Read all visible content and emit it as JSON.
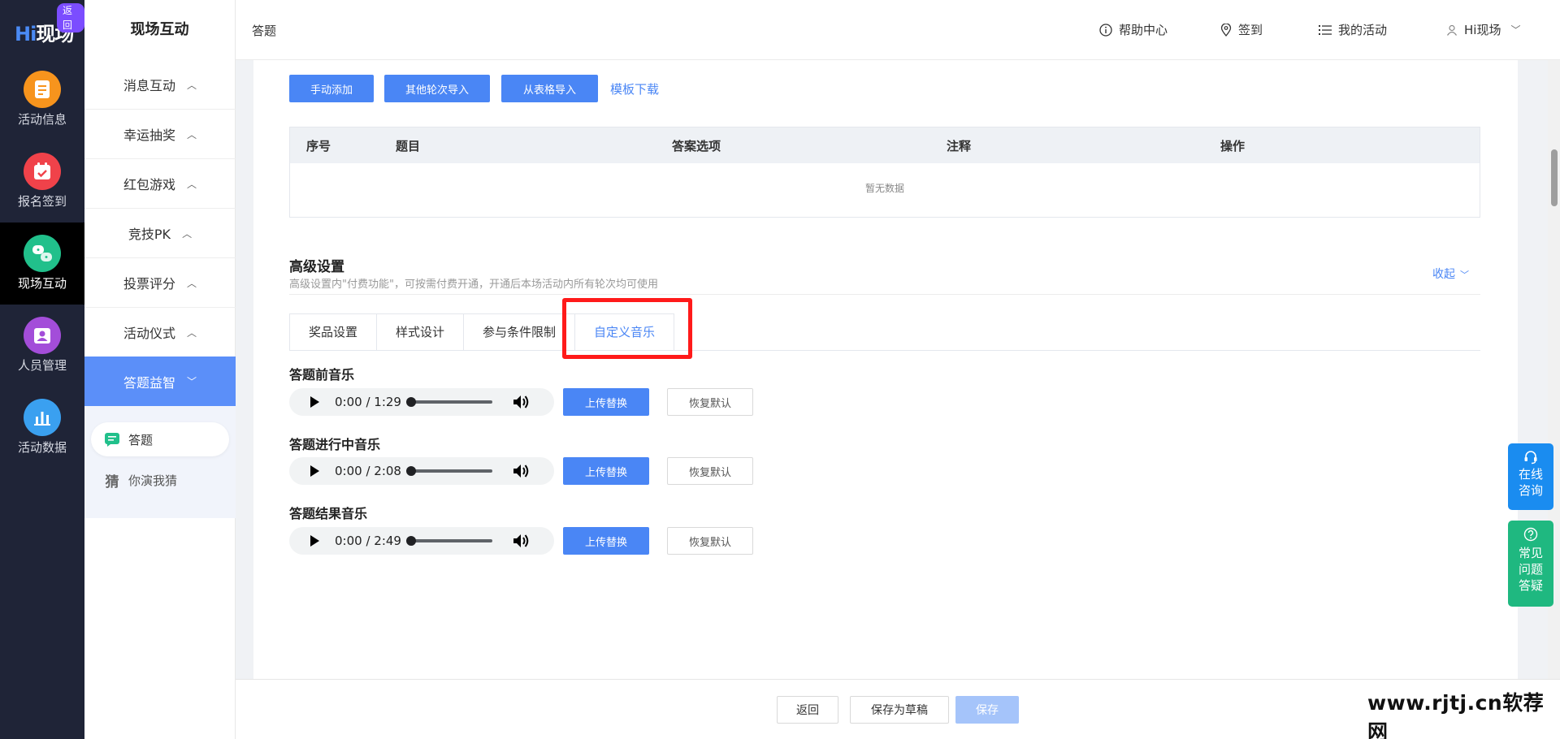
{
  "nav": {
    "logo_hi": "Hi",
    "logo_text": "现场",
    "back_badge": "返回",
    "items": [
      {
        "label": "活动信息",
        "color": "#f7941d"
      },
      {
        "label": "报名签到",
        "color": "#f0424a"
      },
      {
        "label": "现场互动",
        "color": "#21c08b"
      },
      {
        "label": "人员管理",
        "color": "#a34dd9"
      },
      {
        "label": "活动数据",
        "color": "#3aa0f0"
      }
    ]
  },
  "sidebar": {
    "title": "现场互动",
    "items": [
      {
        "label": "消息互动"
      },
      {
        "label": "幸运抽奖"
      },
      {
        "label": "红包游戏"
      },
      {
        "label": "竞技PK"
      },
      {
        "label": "投票评分"
      },
      {
        "label": "活动仪式"
      },
      {
        "label": "答题益智"
      }
    ],
    "subitems": [
      {
        "label": "答题"
      },
      {
        "label": "你演我猜",
        "icon_char": "猜"
      }
    ]
  },
  "header": {
    "breadcrumb": "答题",
    "help": "帮助中心",
    "signin": "签到",
    "my_activity": "我的活动",
    "user": "Hi现场"
  },
  "toolbar": {
    "manual_add": "手动添加",
    "import_other": "其他轮次导入",
    "import_table": "从表格导入",
    "template_download": "模板下载"
  },
  "table": {
    "columns": [
      "序号",
      "题目",
      "答案选项",
      "注释",
      "操作"
    ],
    "empty_text": "暂无数据"
  },
  "advanced": {
    "title": "高级设置",
    "desc": "高级设置内\"付费功能\"，可按需付费开通，开通后本场活动内所有轮次均可使用",
    "collapse": "收起",
    "tabs": [
      "奖品设置",
      "样式设计",
      "参与条件限制",
      "自定义音乐"
    ],
    "active_tab": "自定义音乐"
  },
  "music": [
    {
      "label": "答题前音乐",
      "time": "0:00 / 1:29"
    },
    {
      "label": "答题进行中音乐",
      "time": "0:00 / 2:08"
    },
    {
      "label": "答题结果音乐",
      "time": "0:00 / 2:49"
    }
  ],
  "music_buttons": {
    "upload": "上传替换",
    "reset": "恢复默认"
  },
  "footer": {
    "back": "返回",
    "save_draft": "保存为草稿",
    "save": "保存"
  },
  "float": {
    "online": "在线咨询",
    "online_lines": [
      "在线",
      "咨询"
    ],
    "faq_lines": [
      "常见",
      "问题",
      "答疑"
    ]
  },
  "watermark": "www.rjtj.cn软荐网",
  "colors": {
    "primary": "#4a86f5",
    "nav_bg": "#1f2437",
    "online_bg": "#1a8cf0",
    "faq_bg": "#1fb880"
  }
}
